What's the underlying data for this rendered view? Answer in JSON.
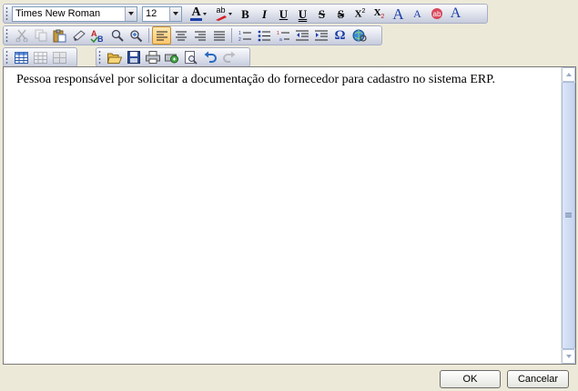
{
  "toolbar": {
    "font_name": "Times New Roman",
    "font_size": "12",
    "row1_icons": [
      "font-color-icon",
      "highlight-color-icon",
      "bold-icon",
      "italic-icon",
      "underline-icon",
      "double-underline-icon",
      "strikethrough-icon",
      "double-strikethrough-icon",
      "superscript-icon",
      "subscript-icon",
      "grow-font-icon",
      "shrink-font-icon",
      "clear-formatting-icon",
      "font-format-icon"
    ],
    "row2_icons": [
      "cut-icon",
      "copy-icon",
      "paste-icon",
      "format-painter-icon",
      "spell-check-icon",
      "find-icon",
      "find-replace-icon",
      "align-left-icon",
      "align-center-icon",
      "align-right-icon",
      "justify-icon",
      "numbered-list-icon",
      "bullet-list-icon",
      "multilevel-list-icon",
      "decrease-indent-icon",
      "increase-indent-icon",
      "insert-symbol-icon",
      "insert-link-icon"
    ],
    "row3_icons": [
      "insert-table-icon",
      "table-properties-icon",
      "table-cells-icon",
      "open-icon",
      "save-icon",
      "print-icon",
      "print-preview-icon",
      "preview-icon",
      "undo-icon",
      "redo-icon"
    ],
    "labels": {
      "bold": "B",
      "italic": "I",
      "underline": "U",
      "double_underline": "U",
      "strikethrough": "S",
      "double_strikethrough": "S",
      "superscript": "X",
      "superscript_mark": "2",
      "subscript": "X",
      "subscript_mark": "2",
      "grow_font": "A",
      "shrink_font": "A",
      "font_format": "A",
      "font_color": "A",
      "highlight": "ab",
      "symbol": "Ω"
    }
  },
  "editor": {
    "content": "Pessoa responsável por solicitar a documentação do fornecedor para cadastro no sistema ERP."
  },
  "buttons": {
    "ok": "OK",
    "cancel": "Cancelar"
  },
  "colors": {
    "active_button": "#fdc76e",
    "toolbar_bg": "#e3e6ef",
    "font_color_bar": "#1c3fa8",
    "highlight_bar": "#d42020"
  }
}
